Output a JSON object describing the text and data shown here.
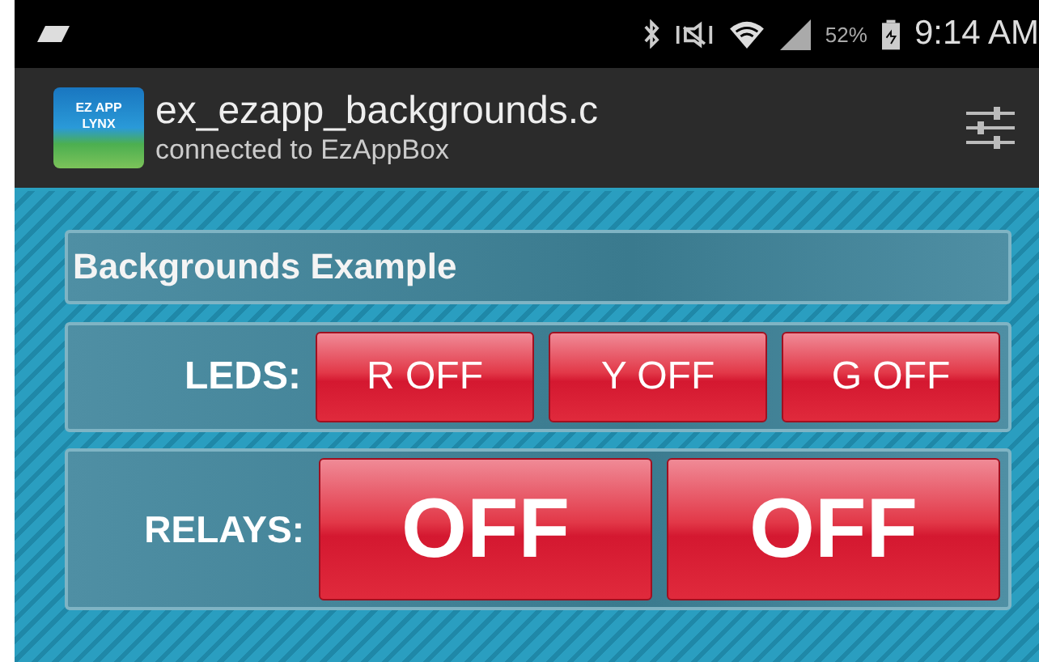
{
  "status_bar": {
    "battery": "52%",
    "time": "9:14 AM"
  },
  "app_bar": {
    "icon_text": [
      "EZ APP",
      "LYNX"
    ],
    "title": "ex_ezapp_backgrounds.c",
    "subtitle": "connected to EzAppBox"
  },
  "header": {
    "title": "Backgrounds Example"
  },
  "rows": [
    {
      "label": "LEDS:",
      "kind": "led",
      "buttons": [
        "R OFF",
        "Y OFF",
        "G OFF"
      ]
    },
    {
      "label": "RELAYS:",
      "kind": "relay",
      "buttons": [
        "OFF",
        "OFF"
      ]
    }
  ]
}
